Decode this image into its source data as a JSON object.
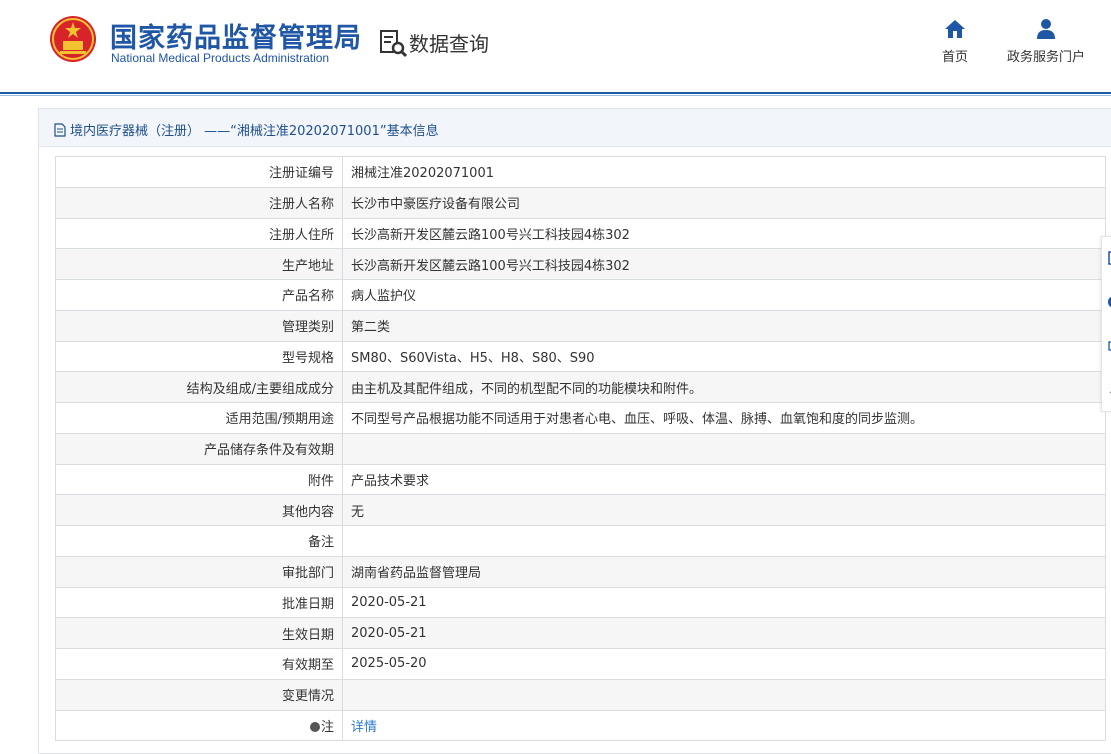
{
  "header": {
    "logo_cn": "国家药品监督管理局",
    "logo_en": "National Medical Products Administration",
    "query_title": "数据查询",
    "nav": [
      {
        "label": "首页",
        "icon": "home-icon"
      },
      {
        "label": "政务服务门户",
        "icon": "user-icon"
      }
    ],
    "brand_color": "#1f56a6",
    "emblem_color": "#d8232a"
  },
  "breadcrumb": {
    "text": "境内医疗器械（注册） ——“湘械注准20202071001”基本信息",
    "icon": "document-icon"
  },
  "table": {
    "rows": [
      {
        "label": "注册证编号",
        "value": "湘械注准20202071001"
      },
      {
        "label": "注册人名称",
        "value": "长沙市中豪医疗设备有限公司"
      },
      {
        "label": "注册人住所",
        "value": "长沙高新开发区麓云路100号兴工科技园4栋302"
      },
      {
        "label": "生产地址",
        "value": "长沙高新开发区麓云路100号兴工科技园4栋302"
      },
      {
        "label": "产品名称",
        "value": "病人监护仪"
      },
      {
        "label": "管理类别",
        "value": "第二类"
      },
      {
        "label": "型号规格",
        "value": "SM80、S60Vista、H5、H8、S80、S90"
      },
      {
        "label": "结构及组成/主要组成成分",
        "value": "由主机及其配件组成，不同的机型配不同的功能模块和附件。"
      },
      {
        "label": "适用范围/预期用途",
        "value": "不同型号产品根据功能不同适用于对患者心电、血压、呼吸、体温、脉搏、血氧饱和度的同步监测。"
      },
      {
        "label": "产品储存条件及有效期",
        "value": ""
      },
      {
        "label": "附件",
        "value": "产品技术要求"
      },
      {
        "label": "其他内容",
        "value": "无"
      },
      {
        "label": "备注",
        "value": ""
      },
      {
        "label": "审批部门",
        "value": "湖南省药品监督管理局"
      },
      {
        "label": "批准日期",
        "value": "2020-05-21"
      },
      {
        "label": "生效日期",
        "value": "2020-05-21"
      },
      {
        "label": "有效期至",
        "value": "2025-05-20"
      },
      {
        "label": "变更情况",
        "value": ""
      }
    ],
    "note_label": "注",
    "note_link": "详情",
    "link_color": "#2b7bd1"
  }
}
